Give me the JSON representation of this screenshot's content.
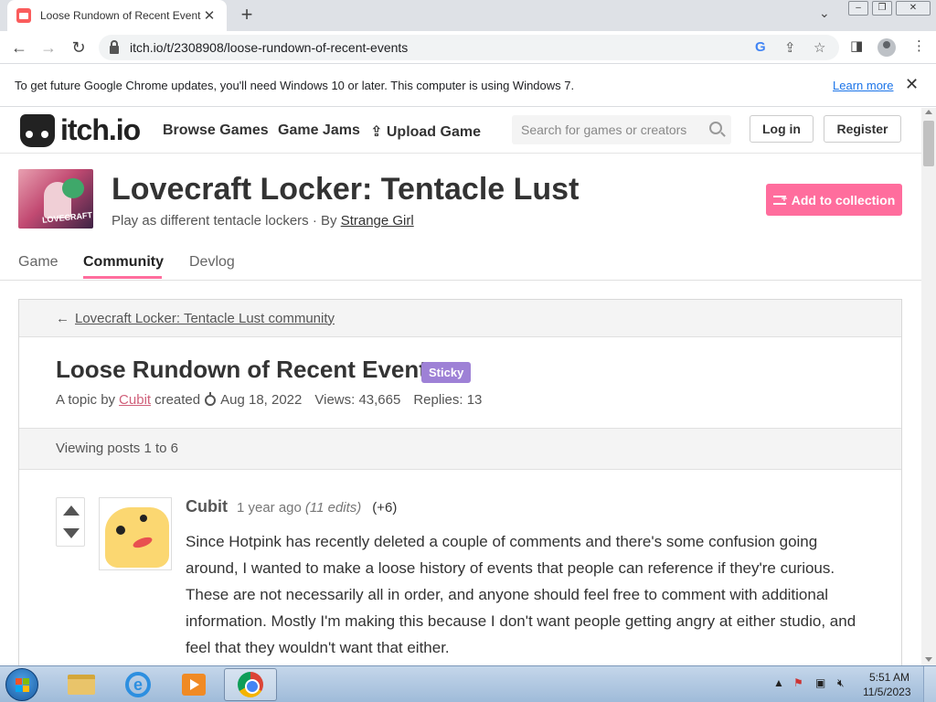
{
  "browser": {
    "tab_title": "Loose Rundown of Recent Events",
    "url": "itch.io/t/2308908/loose-rundown-of-recent-events",
    "infobar_text": "To get future Google Chrome updates, you'll need Windows 10 or later. This computer is using Windows 7.",
    "infobar_link": "Learn more"
  },
  "site": {
    "logo": "itch.io",
    "nav": [
      "Browse Games",
      "Game Jams",
      "Upload Game"
    ],
    "search_placeholder": "Search for games or creators",
    "login": "Log in",
    "register": "Register"
  },
  "game": {
    "title": "Lovecraft Locker: Tentacle Lust",
    "tagline": "Play as different tentacle lockers · By",
    "author": "Strange Girl",
    "collection_button": "Add to collection",
    "cover_text": "LOVECRAFT",
    "tabs": [
      "Game",
      "Community",
      "Devlog"
    ]
  },
  "topic": {
    "breadcrumb": "Lovecraft Locker: Tentacle Lust community",
    "title": "Loose Rundown of Recent Events",
    "badge": "Sticky",
    "by_prefix": "A topic by",
    "author": "Cubit",
    "created_label": "created",
    "date": "Aug 18, 2022",
    "views": "Views: 43,665",
    "replies": "Replies: 13",
    "viewing": "Viewing posts 1 to 6"
  },
  "post": {
    "author": "Cubit",
    "time": "1 year ago",
    "edits": "(11 edits)",
    "score": "(+6)",
    "body": "Since Hotpink has recently deleted a couple of comments and there's some confusion going around, I wanted to make a loose history of events that people can reference if they're curious. These are not necessarily all in order, and anyone should feel free to comment with additional information. Mostly I'm making this because I don't want people getting angry at either studio, and feel that they wouldn't want that either."
  },
  "taskbar": {
    "time": "5:51 AM",
    "date": "11/5/2023"
  },
  "colors": {
    "accent_pink": "#ff6d9d",
    "sticky_purple": "#9e81d6",
    "link_blue": "#1a73e8"
  }
}
